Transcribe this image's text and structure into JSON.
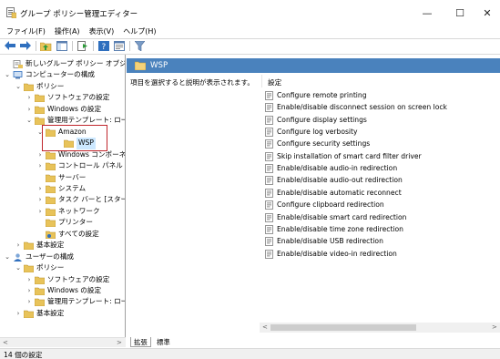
{
  "window": {
    "title": "グループ ポリシー管理エディター",
    "minimize_glyph": "—",
    "maximize_glyph": "☐",
    "close_glyph": "✕"
  },
  "menu": [
    {
      "label": "ファイル(F)"
    },
    {
      "label": "操作(A)"
    },
    {
      "label": "表示(V)"
    },
    {
      "label": "ヘルプ(H)"
    }
  ],
  "toolbar": {
    "icons": [
      "back-icon",
      "forward-icon",
      "folder-up-icon",
      "show-hide-tree-icon",
      "export-list-icon",
      "help-icon",
      "properties-icon",
      "filter-icon"
    ]
  },
  "tree": [
    {
      "label": "新しいグループ ポリシー オブジェクト [",
      "expander": "",
      "icon": "policy-doc-icon"
    },
    {
      "label": "コンピューターの構成",
      "expander": "⌄",
      "icon": "computer-icon"
    },
    {
      "label": "ポリシー",
      "expander": "⌄",
      "icon": "folder-icon"
    },
    {
      "label": "ソフトウェアの設定",
      "expander": "›",
      "icon": "folder-icon"
    },
    {
      "label": "Windows の設定",
      "expander": "›",
      "icon": "folder-icon"
    },
    {
      "label": "管理用テンプレート: ロー",
      "expander": "⌄",
      "icon": "folder-icon"
    },
    {
      "label": "Amazon",
      "expander": "⌄",
      "icon": "folder-icon"
    },
    {
      "label": "WSP",
      "expander": "",
      "icon": "folder-icon"
    },
    {
      "label": "Windows コンポーネ",
      "expander": "›",
      "icon": "folder-icon"
    },
    {
      "label": "コントロール パネル",
      "expander": "›",
      "icon": "folder-icon"
    },
    {
      "label": "サーバー",
      "expander": "",
      "icon": "folder-icon"
    },
    {
      "label": "システム",
      "expander": "›",
      "icon": "folder-icon"
    },
    {
      "label": "タスク バーと [スター",
      "expander": "›",
      "icon": "folder-icon"
    },
    {
      "label": "ネットワーク",
      "expander": "›",
      "icon": "folder-icon"
    },
    {
      "label": "プリンター",
      "expander": "",
      "icon": "folder-icon"
    },
    {
      "label": "すべての設定",
      "expander": "",
      "icon": "all-settings-icon"
    },
    {
      "label": "基本設定",
      "expander": "›",
      "icon": "folder-icon"
    },
    {
      "label": "ユーザーの構成",
      "expander": "⌄",
      "icon": "user-icon"
    },
    {
      "label": "ポリシー",
      "expander": "⌄",
      "icon": "folder-icon"
    },
    {
      "label": "ソフトウェアの設定",
      "expander": "›",
      "icon": "folder-icon"
    },
    {
      "label": "Windows の設定",
      "expander": "›",
      "icon": "folder-icon"
    },
    {
      "label": "管理用テンプレート: ロー",
      "expander": "›",
      "icon": "folder-icon"
    },
    {
      "label": "基本設定",
      "expander": "›",
      "icon": "folder-icon"
    }
  ],
  "details": {
    "header_title": "WSP",
    "description": "項目を選択すると説明が表示されます。",
    "column_header": "設定",
    "settings": [
      {
        "label": "Configure remote printing"
      },
      {
        "label": "Enable/disable disconnect session on screen lock"
      },
      {
        "label": "Configure display settings"
      },
      {
        "label": "Configure log verbosity"
      },
      {
        "label": "Configure security settings"
      },
      {
        "label": "Skip installation of smart card filter driver"
      },
      {
        "label": "Enable/disable audio-in redirection"
      },
      {
        "label": "Enable/disable audio-out redirection"
      },
      {
        "label": "Enable/disable automatic reconnect"
      },
      {
        "label": "Configure clipboard redirection"
      },
      {
        "label": "Enable/disable smart card redirection"
      },
      {
        "label": "Enable/disable time zone redirection"
      },
      {
        "label": "Enable/disable USB redirection"
      },
      {
        "label": "Enable/disable video-in redirection"
      }
    ]
  },
  "scroll": {
    "left_arrow": "<",
    "right_arrow": ">"
  },
  "tabs": [
    {
      "label": "拡張"
    },
    {
      "label": "標準"
    }
  ],
  "status": {
    "text": "14 個の設定"
  },
  "colors": {
    "header_blue": "#4a82bd",
    "folder_yellow": "#e8c35a",
    "highlight_red": "#c0262c",
    "selection_blue": "#cce8ff"
  }
}
